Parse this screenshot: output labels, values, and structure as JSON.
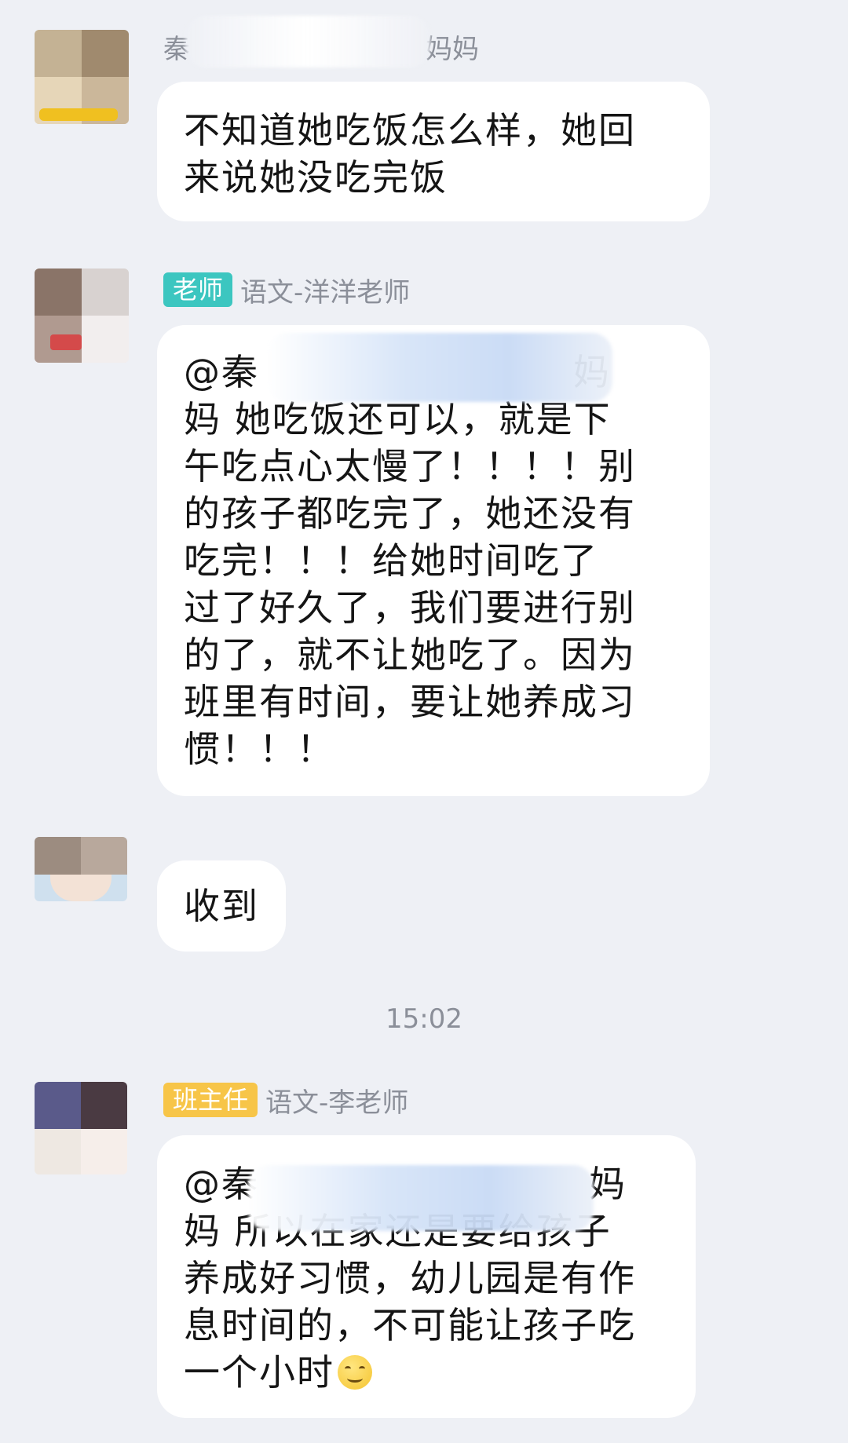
{
  "messages": [
    {
      "sender": {
        "name_visible_prefix": "秦",
        "name_visible_suffix": "妈妈"
      },
      "lines": [
        "不知道她吃饭怎么样，她回",
        "来说她没吃完饭"
      ]
    },
    {
      "sender": {
        "role_badge": "老师",
        "name": "语文-洋洋老师",
        "badge_color": "#3cc6c0"
      },
      "mention_prefix": "@秦",
      "mention_suffix": "妈",
      "lines": [
        "妈 她吃饭还可以，就是下",
        "午吃点心太慢了！！！！别",
        "的孩子都吃完了，她还没有",
        "吃完！！！给她时间吃了",
        "过了好久了，我们要进行别",
        "的了，就不让她吃了。因为",
        "班里有时间，要让她养成习",
        "惯！！！"
      ]
    },
    {
      "lines": [
        "收到"
      ]
    },
    {
      "sender": {
        "role_badge": "班主任",
        "name": "语文-李老师",
        "badge_color": "#f7c548"
      },
      "mention_prefix": "@秦",
      "mention_suffix": "妈",
      "lines": [
        "妈 所以在家还是要给孩子",
        "养成好习惯，幼儿园是有作",
        "息时间的，不可能让孩子吃",
        "一个小时"
      ],
      "trailing_emoji": "smiling-face-icon"
    }
  ],
  "timestamp": "15:02",
  "colors": {
    "background": "#eef0f5",
    "bubble": "#ffffff",
    "meta_text": "#8b8f99"
  }
}
